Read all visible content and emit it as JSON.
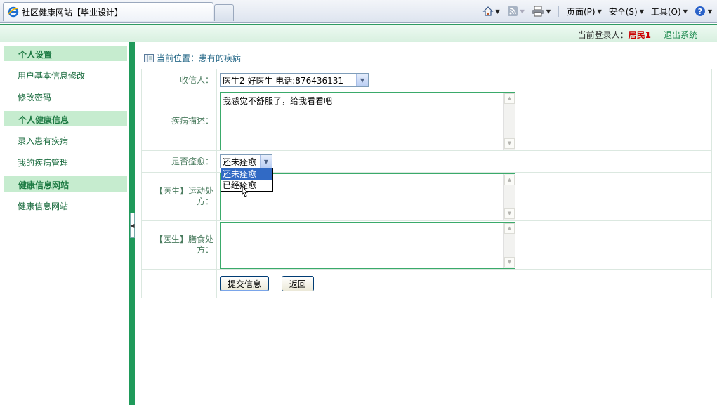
{
  "browser": {
    "tab_title": "社区健康网站【毕业设计】",
    "menus": {
      "page": "页面(P)",
      "safety": "安全(S)",
      "tools": "工具(O)"
    }
  },
  "header": {
    "login_label": "当前登录人：",
    "login_user": "居民1",
    "logout": "退出系统"
  },
  "sidebar": {
    "sections": [
      {
        "title": "个人设置",
        "items": [
          "用户基本信息修改",
          "修改密码"
        ]
      },
      {
        "title": "个人健康信息",
        "items": [
          "录入患有疾病",
          "我的疾病管理"
        ]
      },
      {
        "title": "健康信息网站",
        "items": [
          "健康信息网站"
        ]
      }
    ]
  },
  "breadcrumb": "当前位置：患有的疾病",
  "form": {
    "recipient_label": "收信人：",
    "recipient_value": "医生2 好医生  电话:876436131",
    "desc_label": "疾病描述：",
    "desc_value": "我感觉不舒服了，给我看看吧",
    "cured_label": "是否痊愈：",
    "cured_value": "还未痊愈",
    "cured_options": [
      "还未痊愈",
      "已经痊愈"
    ],
    "exercise_label": "【医生】运动处方：",
    "diet_label": "【医生】膳食处方：",
    "submit": "提交信息",
    "back": "返回"
  },
  "colors": {
    "accent": "#1f9a5a",
    "section_bg": "#c6eccf",
    "user": "#cc0000"
  }
}
